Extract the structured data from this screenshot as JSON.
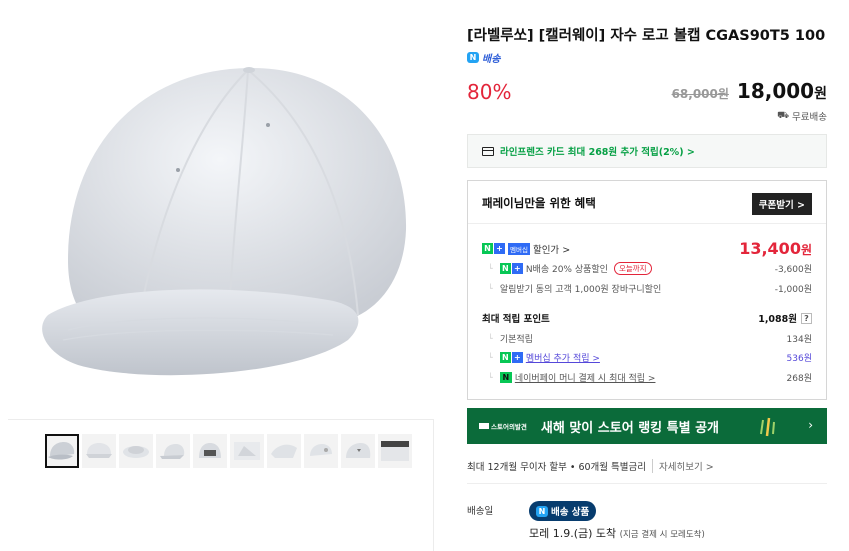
{
  "product": {
    "title": "[라벨루쏘] [캘러웨이] 자수 로고 볼캡 CGAS90T5 100",
    "delivery_tag": "배송",
    "discount": "80%",
    "original_price": "68,000원",
    "sale_price": "18,000",
    "sale_unit": "원",
    "free_shipping": "무료배송"
  },
  "card_benefit": "라인프렌즈 카드 최대 268원 추가 적립(2%) >",
  "benefits": {
    "title": "패레이님만을 위한 혜택",
    "coupon_button": "쿠폰받기 >",
    "discount_label": "할인가 >",
    "membership_chip": "멤버십",
    "discount_price": "13,400",
    "discount_unit": "원",
    "n_delivery_label": "N배송 20% 상품할인",
    "today_chip": "오늘까지",
    "n_delivery_value": "-3,600원",
    "alert_label": "알림받기 동의 고객 1,000원 장바구니할인",
    "alert_value": "-1,000원",
    "points_label": "최대 적립 포인트",
    "points_value": "1,088원",
    "points_help": "?",
    "basic_label": "기본적립",
    "basic_value": "134원",
    "member_label": "멤버십 추가 적립 >",
    "member_value": "536원",
    "npay_label": "네이버페이 머니 결제 시 최대 적립 >",
    "npay_value": "268원"
  },
  "banner": {
    "logo": "스토어의발견",
    "text": "새해 맞이 스토어 랭킹 특별 공개",
    "arrow": "›"
  },
  "installment": {
    "text": "최대 12개월 무이자 할부 • 60개월 특별금리",
    "more": "자세히보기 >"
  },
  "shipping": {
    "label": "배송일",
    "chip": "배송 상품",
    "date": "모레 1.9.(금) 도착",
    "date_note": "(지금 결제 시 모레도착)"
  },
  "colors": {
    "accent_red": "#e3253a",
    "naver_green": "#07c755",
    "banner_green": "#0b6b3a",
    "purple_link": "#5548d9",
    "delivery_navy": "#073c6e"
  }
}
